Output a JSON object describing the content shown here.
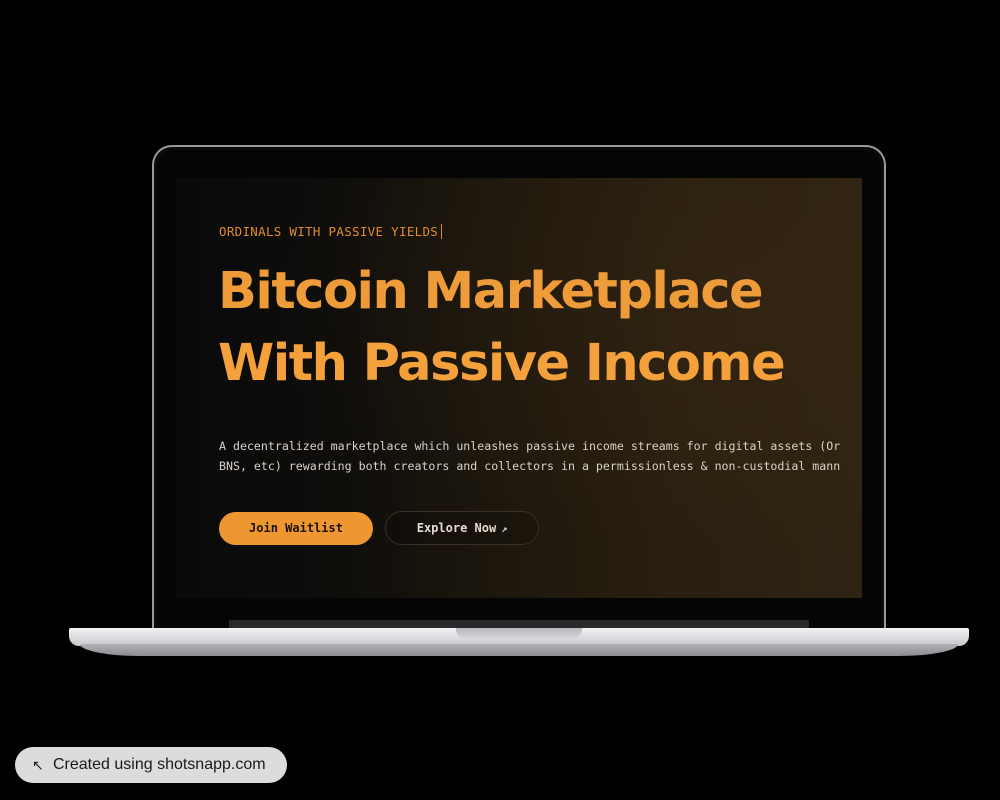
{
  "hero": {
    "eyebrow": "ORDINALS WITH PASSIVE YIELDS",
    "headline_line1": "Bitcoin Marketplace",
    "headline_line2": "With Passive Income",
    "description_line1": "A decentralized marketplace which unleashes passive income streams for digital assets (Or",
    "description_line2": "BNS, etc) rewarding both creators and collectors in a permissionless & non-custodial mann",
    "join_label": "Join Waitlist",
    "explore_label": "Explore Now",
    "explore_icon": "arrow-up-right-icon"
  },
  "badge": {
    "icon": "arrow-up-left-icon",
    "text": "Created using shotsnapp.com"
  },
  "colors": {
    "accent": "#ee9630",
    "background": "#000000",
    "headline": "#ee9b3a",
    "eyebrow": "#e08b2e"
  }
}
